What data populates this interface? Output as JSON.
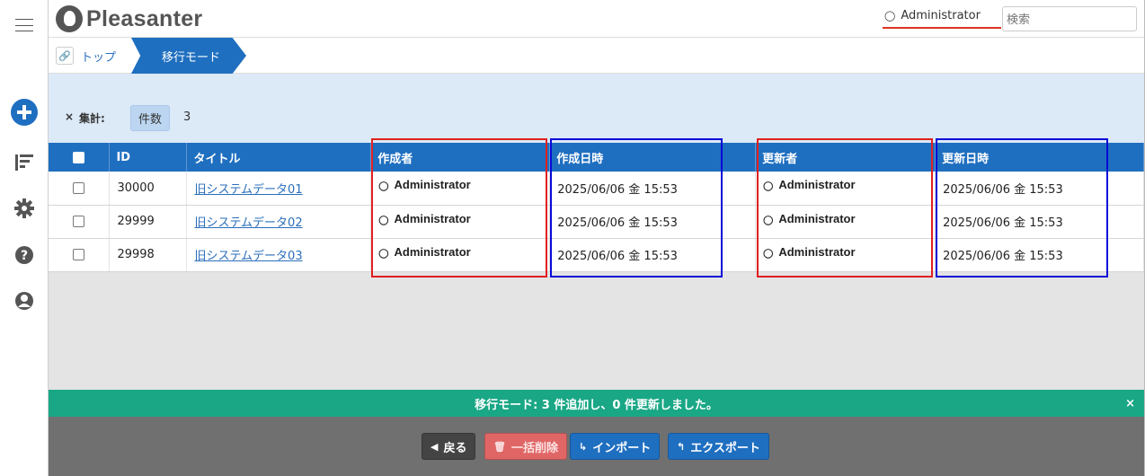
{
  "app": {
    "name": "Pleasanter"
  },
  "header": {
    "user_name": "Administrator",
    "search_placeholder": "検索"
  },
  "breadcrumb": {
    "items": [
      "トップ",
      "移行モード"
    ]
  },
  "aggregation": {
    "close": "×",
    "label": "集計:",
    "chip": "件数",
    "count": "3"
  },
  "table": {
    "headers": [
      "ID",
      "タイトル",
      "作成者",
      "作成日時",
      "更新者",
      "更新日時"
    ],
    "rows": [
      {
        "id": "30000",
        "title": "旧システムデータ01",
        "creator": "Administrator",
        "created": "2025/06/06 金 15:53",
        "updater": "Administrator",
        "updated": "2025/06/06 金 15:53"
      },
      {
        "id": "29999",
        "title": "旧システムデータ02",
        "creator": "Administrator",
        "created": "2025/06/06 金 15:53",
        "updater": "Administrator",
        "updated": "2025/06/06 金 15:53"
      },
      {
        "id": "29998",
        "title": "旧システムデータ03",
        "creator": "Administrator",
        "created": "2025/06/06 金 15:53",
        "updater": "Administrator",
        "updated": "2025/06/06 金 15:53"
      }
    ]
  },
  "message": {
    "text": "移行モード: 3 件追加し、0 件更新しました。",
    "close": "×"
  },
  "footer": {
    "back": "戻る",
    "bulk_delete": "一括削除",
    "import": "インポート",
    "export": "エクスポート"
  },
  "colors": {
    "primary": "#1f6fc0",
    "success": "#19a785",
    "danger": "#e06666",
    "highlight_red": "#e02020",
    "highlight_blue": "#0a0ad8"
  },
  "icons": [
    "menu-icon",
    "plus-circle-icon",
    "sort-icon",
    "gear-icon",
    "help-icon",
    "user-circle-icon",
    "user-icon",
    "link-icon"
  ]
}
